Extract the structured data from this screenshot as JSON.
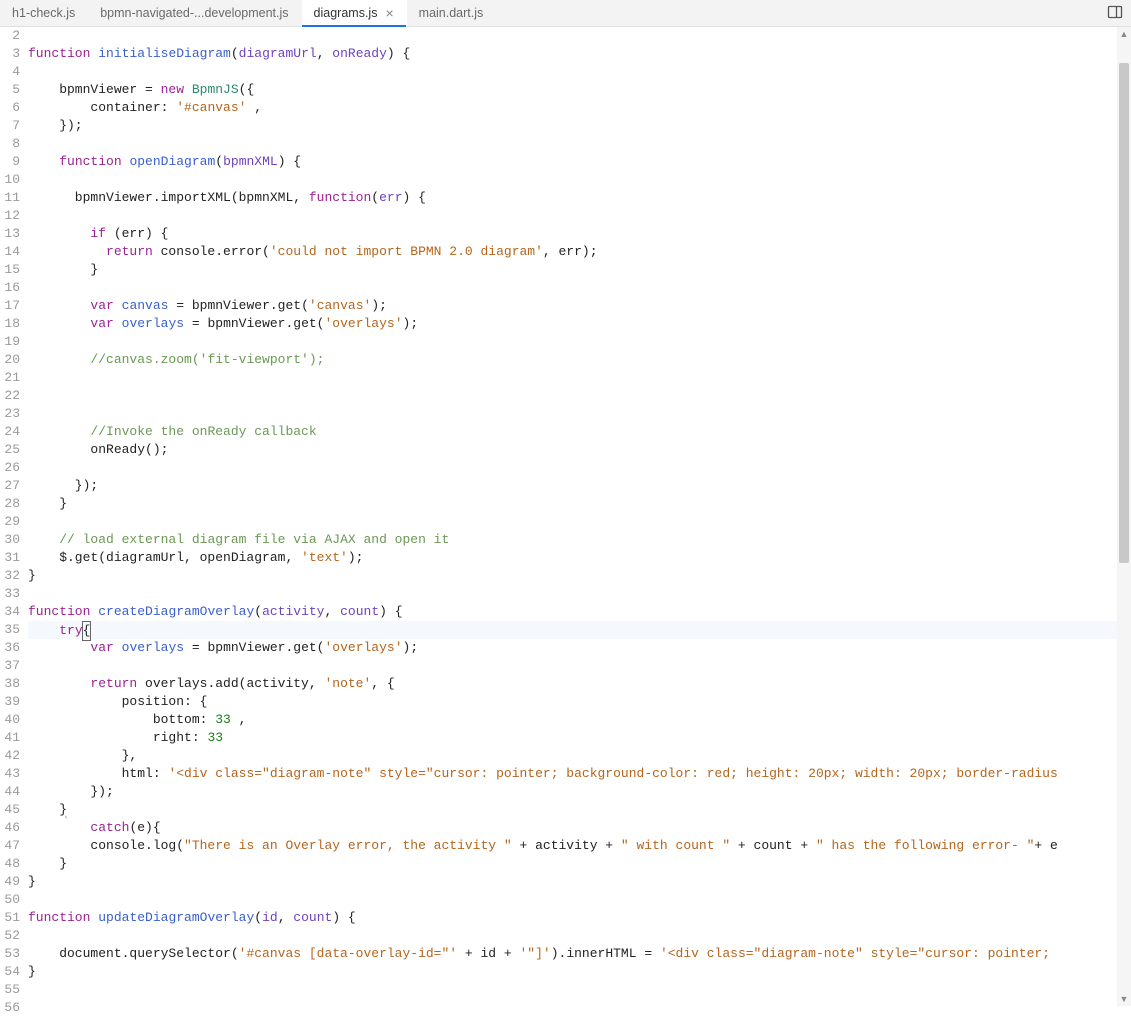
{
  "tabs": [
    {
      "label": "h1-check.js",
      "active": false,
      "closable": false
    },
    {
      "label": "bpmn-navigated-...development.js",
      "active": false,
      "closable": false
    },
    {
      "label": "diagrams.js",
      "active": true,
      "closable": true
    },
    {
      "label": "main.dart.js",
      "active": false,
      "closable": false
    }
  ],
  "gutter_start": 2,
  "gutter_end": 56,
  "code_lines": [
    {
      "n": 2,
      "tokens": []
    },
    {
      "n": 3,
      "tokens": [
        [
          "kw",
          "function"
        ],
        [
          " "
        ],
        [
          "fn",
          "initialiseDiagram"
        ],
        [
          "("
        ],
        [
          "param",
          "diagramUrl"
        ],
        [
          ", "
        ],
        [
          "param",
          "onReady"
        ],
        [
          ") {"
        ]
      ]
    },
    {
      "n": 4,
      "tokens": []
    },
    {
      "n": 5,
      "tokens": [
        [
          "    bpmnViewer = "
        ],
        [
          "kw",
          "new"
        ],
        [
          " "
        ],
        [
          "cls",
          "BpmnJS"
        ],
        [
          "({"
        ]
      ]
    },
    {
      "n": 6,
      "tokens": [
        [
          "        container: "
        ],
        [
          "str",
          "'#canvas'"
        ],
        [
          " ,"
        ]
      ]
    },
    {
      "n": 7,
      "tokens": [
        [
          "    });"
        ]
      ]
    },
    {
      "n": 8,
      "tokens": []
    },
    {
      "n": 9,
      "tokens": [
        [
          "    "
        ],
        [
          "kw",
          "function"
        ],
        [
          " "
        ],
        [
          "fn",
          "openDiagram"
        ],
        [
          "("
        ],
        [
          "param",
          "bpmnXML"
        ],
        [
          ") {"
        ]
      ]
    },
    {
      "n": 10,
      "tokens": []
    },
    {
      "n": 11,
      "tokens": [
        [
          "      bpmnViewer.importXML(bpmnXML, "
        ],
        [
          "kw",
          "function"
        ],
        [
          "("
        ],
        [
          "param",
          "err"
        ],
        [
          ") {"
        ]
      ]
    },
    {
      "n": 12,
      "tokens": []
    },
    {
      "n": 13,
      "tokens": [
        [
          "        "
        ],
        [
          "kw",
          "if"
        ],
        [
          " (err) {"
        ]
      ]
    },
    {
      "n": 14,
      "tokens": [
        [
          "          "
        ],
        [
          "kw",
          "return"
        ],
        [
          " console.error("
        ],
        [
          "str",
          "'could not import BPMN 2.0 diagram'"
        ],
        [
          ", err);"
        ]
      ]
    },
    {
      "n": 15,
      "tokens": [
        [
          "        }"
        ]
      ]
    },
    {
      "n": 16,
      "tokens": []
    },
    {
      "n": 17,
      "tokens": [
        [
          "        "
        ],
        [
          "kw",
          "var"
        ],
        [
          " "
        ],
        [
          "fn",
          "canvas"
        ],
        [
          " = bpmnViewer.get("
        ],
        [
          "str",
          "'canvas'"
        ],
        [
          ");"
        ]
      ]
    },
    {
      "n": 18,
      "tokens": [
        [
          "        "
        ],
        [
          "kw",
          "var"
        ],
        [
          " "
        ],
        [
          "fn",
          "overlays"
        ],
        [
          " = bpmnViewer.get("
        ],
        [
          "str",
          "'overlays'"
        ],
        [
          ");"
        ]
      ]
    },
    {
      "n": 19,
      "tokens": []
    },
    {
      "n": 20,
      "tokens": [
        [
          "        "
        ],
        [
          "comment",
          "//canvas.zoom('fit-viewport');"
        ]
      ]
    },
    {
      "n": 21,
      "tokens": []
    },
    {
      "n": 22,
      "tokens": []
    },
    {
      "n": 23,
      "tokens": []
    },
    {
      "n": 24,
      "tokens": [
        [
          "        "
        ],
        [
          "comment",
          "//Invoke the onReady callback"
        ]
      ]
    },
    {
      "n": 25,
      "tokens": [
        [
          "        onReady();"
        ]
      ]
    },
    {
      "n": 26,
      "tokens": []
    },
    {
      "n": 27,
      "tokens": [
        [
          "      });"
        ]
      ]
    },
    {
      "n": 28,
      "tokens": [
        [
          "    }"
        ]
      ]
    },
    {
      "n": 29,
      "tokens": []
    },
    {
      "n": 30,
      "tokens": [
        [
          "    "
        ],
        [
          "comment",
          "// load external diagram file via AJAX and open it"
        ]
      ]
    },
    {
      "n": 31,
      "tokens": [
        [
          "    $.get(diagramUrl, openDiagram, "
        ],
        [
          "str",
          "'text'"
        ],
        [
          ");"
        ]
      ]
    },
    {
      "n": 32,
      "tokens": [
        [
          "}"
        ]
      ]
    },
    {
      "n": 33,
      "tokens": []
    },
    {
      "n": 34,
      "tokens": [
        [
          "kw",
          "function"
        ],
        [
          " "
        ],
        [
          "fn",
          "createDiagramOverlay"
        ],
        [
          "("
        ],
        [
          "param",
          "activity"
        ],
        [
          ", "
        ],
        [
          "param",
          "count"
        ],
        [
          ") {"
        ]
      ]
    },
    {
      "n": 35,
      "tokens": [
        [
          "    "
        ],
        [
          "kw",
          "try"
        ],
        [
          "box",
          "{"
        ]
      ]
    },
    {
      "n": 36,
      "tokens": [
        [
          "        "
        ],
        [
          "kw",
          "var"
        ],
        [
          " "
        ],
        [
          "fn",
          "overlays"
        ],
        [
          " = bpmnViewer.get("
        ],
        [
          "str",
          "'overlays'"
        ],
        [
          ");"
        ]
      ]
    },
    {
      "n": 37,
      "tokens": []
    },
    {
      "n": 38,
      "tokens": [
        [
          "        "
        ],
        [
          "kw",
          "return"
        ],
        [
          " overlays.add(activity, "
        ],
        [
          "str",
          "'note'"
        ],
        [
          ", {"
        ]
      ]
    },
    {
      "n": 39,
      "tokens": [
        [
          "            position: {"
        ]
      ]
    },
    {
      "n": 40,
      "tokens": [
        [
          "                bottom: "
        ],
        [
          "num",
          "33"
        ],
        [
          " ,"
        ]
      ]
    },
    {
      "n": 41,
      "tokens": [
        [
          "                right: "
        ],
        [
          "num",
          "33"
        ]
      ]
    },
    {
      "n": 42,
      "tokens": [
        [
          "            },"
        ]
      ]
    },
    {
      "n": 43,
      "tokens": [
        [
          "            html: "
        ],
        [
          "str",
          "'<div class=\"diagram-note\" style=\"cursor: pointer; background-color: red; height: 20px; width: 20px; border-radius"
        ]
      ]
    },
    {
      "n": 44,
      "tokens": [
        [
          "        });"
        ]
      ]
    },
    {
      "n": 45,
      "tokens": [
        [
          "    "
        ],
        [
          "under",
          "}"
        ]
      ]
    },
    {
      "n": 46,
      "tokens": [
        [
          "        "
        ],
        [
          "kw",
          "catch"
        ],
        [
          "(e){"
        ]
      ]
    },
    {
      "n": 47,
      "tokens": [
        [
          "        console.log("
        ],
        [
          "str",
          "\"There is an Overlay error, the activity \""
        ],
        [
          " + activity + "
        ],
        [
          "str",
          "\" with count \""
        ],
        [
          " + count + "
        ],
        [
          "str",
          "\" has the following error- \""
        ],
        [
          "+ e"
        ]
      ]
    },
    {
      "n": 48,
      "tokens": [
        [
          "    }"
        ]
      ]
    },
    {
      "n": 49,
      "tokens": [
        [
          "}"
        ]
      ]
    },
    {
      "n": 50,
      "tokens": []
    },
    {
      "n": 51,
      "tokens": [
        [
          "kw",
          "function"
        ],
        [
          " "
        ],
        [
          "fn",
          "updateDiagramOverlay"
        ],
        [
          "("
        ],
        [
          "param",
          "id"
        ],
        [
          ", "
        ],
        [
          "param",
          "count"
        ],
        [
          ") {"
        ]
      ]
    },
    {
      "n": 52,
      "tokens": []
    },
    {
      "n": 53,
      "tokens": [
        [
          "    document.querySelector("
        ],
        [
          "str",
          "'#canvas [data-overlay-id=\"'"
        ],
        [
          " + id + "
        ],
        [
          "str",
          "'\"]'"
        ],
        [
          ").innerHTML = "
        ],
        [
          "str",
          "'<div class=\"diagram-note\" style=\"cursor: pointer;"
        ]
      ]
    },
    {
      "n": 54,
      "tokens": [
        [
          "}"
        ]
      ]
    },
    {
      "n": 55,
      "tokens": []
    },
    {
      "n": 56,
      "tokens": []
    }
  ],
  "cursor_line": 35
}
